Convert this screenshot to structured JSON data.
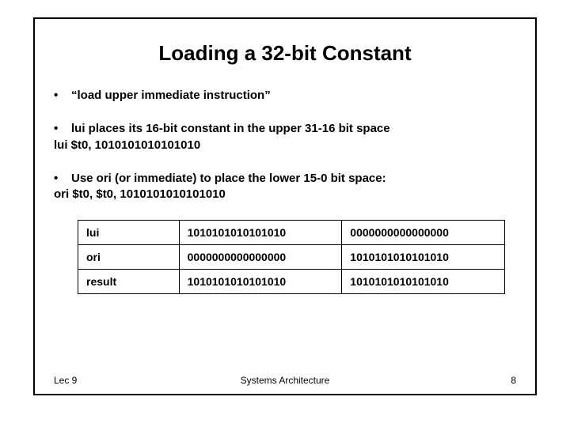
{
  "title": "Loading a 32-bit Constant",
  "bullets": {
    "b1": "“load upper immediate instruction”",
    "b2": "lui places its 16-bit constant in the upper 31-16 bit space",
    "b2code": "lui $t0, 1010101010101010",
    "b3": "Use ori (or immediate) to place the lower 15-0 bit space:",
    "b3code": "ori $t0, $t0, 1010101010101010"
  },
  "table": {
    "rows": [
      {
        "label": "lui",
        "hi": "1010101010101010",
        "lo": "0000000000000000"
      },
      {
        "label": "ori",
        "hi": "0000000000000000",
        "lo": "1010101010101010"
      },
      {
        "label": "result",
        "hi": "1010101010101010",
        "lo": "1010101010101010"
      }
    ]
  },
  "footer": {
    "left": "Lec 9",
    "center": "Systems Architecture",
    "right": "8"
  }
}
